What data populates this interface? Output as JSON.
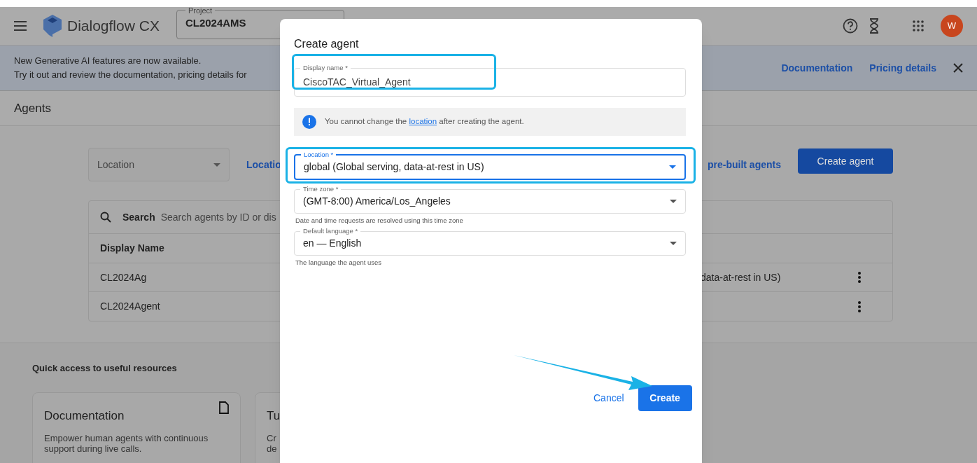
{
  "header": {
    "app_title": "Dialogflow CX",
    "project": {
      "label": "Project",
      "value": "CL2024AMS"
    },
    "avatar": "W"
  },
  "banner": {
    "lines": [
      "New Generative AI features are now available.",
      "Try it out and review the documentation, pricing details for"
    ],
    "links": [
      "Documentation",
      "Pricing details"
    ]
  },
  "page_title": "Agents",
  "filter": {
    "location_placeholder": "Location",
    "location_link": "Locatio",
    "prebuilt_link": "pre-built agents",
    "create_button": "Create agent"
  },
  "search": {
    "label": "Search",
    "placeholder": "Search agents by ID or dis"
  },
  "table": {
    "columns": [
      "Display Name"
    ],
    "rows": [
      {
        "name": "CL2024Ag",
        "column_2": "data-at-rest in US)"
      },
      {
        "name": "CL2024Agent"
      }
    ]
  },
  "quick_access": {
    "title": "Quick access to useful resources",
    "cards": [
      {
        "title": "Documentation",
        "lines": [
          "Empower human agents with continuous",
          "support during live calls."
        ]
      },
      {
        "title": "Tu",
        "lines": [
          "Cr",
          "de"
        ]
      }
    ]
  },
  "dialog": {
    "title": "Create agent",
    "fields": [
      {
        "kind": "text",
        "label": "Display name *",
        "value": "CiscoTAC_Virtual_Agent",
        "focused": false,
        "highlighted": true
      },
      {
        "kind": "notice",
        "before": "You cannot change the ",
        "link": "location",
        "after": " after creating the agent."
      },
      {
        "kind": "select",
        "label": "Location *",
        "value": "global (Global serving, data-at-rest in US)",
        "focused": true,
        "highlighted": true
      },
      {
        "kind": "select",
        "label": "Time zone *",
        "value": "(GMT-8:00) America/Los_Angeles",
        "hint": "Date and time requests are resolved using this time zone",
        "focused": false
      },
      {
        "kind": "select",
        "label": "Default language *",
        "value": "en — English",
        "hint": "The language the agent uses",
        "focused": false
      }
    ],
    "cancel": "Cancel",
    "create": "Create"
  }
}
